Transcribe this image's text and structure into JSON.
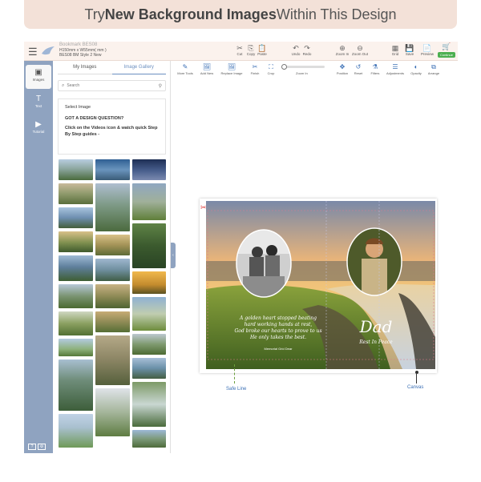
{
  "banner": {
    "prefix": "Try ",
    "highlight": "New Background Images",
    "suffix": " Within This Design"
  },
  "header": {
    "doc_title": "Bookmark BES08",
    "doc_size": "H150mm x W55mm( mm )",
    "doc_style": "BES08 BM Style 2 New",
    "buttons": [
      {
        "label": "Cut",
        "icon": "✂"
      },
      {
        "label": "Copy",
        "icon": "⎘"
      },
      {
        "label": "Paste",
        "icon": "📋"
      },
      {
        "label": "Undo",
        "icon": "↶"
      },
      {
        "label": "Redo",
        "icon": "↷"
      },
      {
        "label": "Zoom In",
        "icon": "⊕"
      },
      {
        "label": "Zoom Out",
        "icon": "⊖"
      },
      {
        "label": "Grid",
        "icon": "▦"
      },
      {
        "label": "Save",
        "icon": "💾"
      },
      {
        "label": "Preview",
        "icon": "📄"
      },
      {
        "label": "Continue",
        "icon": "🛒"
      }
    ]
  },
  "rail": {
    "items": [
      {
        "label": "Images",
        "icon": "▣"
      },
      {
        "label": "Text",
        "icon": "T"
      },
      {
        "label": "Tutorial",
        "icon": "▶"
      }
    ],
    "footer": [
      "?",
      "⚙"
    ]
  },
  "panel": {
    "tabs": [
      "My Images",
      "Image Gallery"
    ],
    "search_placeholder": "Search",
    "info": {
      "select": "Select Image",
      "question": "GOT A DESIGN QUESTION?",
      "guide": "Click on the Videos icon & watch quick Step By Step guides -"
    }
  },
  "toolbar": {
    "tools": [
      {
        "label": "More Tools",
        "icon": "✎"
      },
      {
        "label": "Add New",
        "icon": "🖼"
      },
      {
        "label": "Replace Image",
        "icon": "🖼"
      },
      {
        "label": "Finish",
        "icon": "✂"
      },
      {
        "label": "Crop",
        "icon": "⛶"
      },
      {
        "label": "Position",
        "icon": "✥"
      },
      {
        "label": "Reset",
        "icon": "↺"
      },
      {
        "label": "Filters",
        "icon": "⚗"
      },
      {
        "label": "Adjustments",
        "icon": "☰"
      },
      {
        "label": "Opacity",
        "icon": "◐"
      },
      {
        "label": "Arrange",
        "icon": "⧉"
      }
    ],
    "zoom_label": "Zoom In"
  },
  "design": {
    "verse": [
      "A golden heart stopped beating",
      "hard working hands at rest,",
      "God broke our hearts to prove to us",
      "He only takes the best."
    ],
    "caption": "Memorial Grid Dear",
    "name": "Dad",
    "subtitle": "Rest In Peace"
  },
  "callouts": {
    "safe_line": "Safe Line",
    "canvas": "Canvas"
  },
  "colors": {
    "accent": "#3a6fb5",
    "rail": "#8fa3c0",
    "continue": "#4caf50",
    "banner": "#f3e1d8"
  }
}
